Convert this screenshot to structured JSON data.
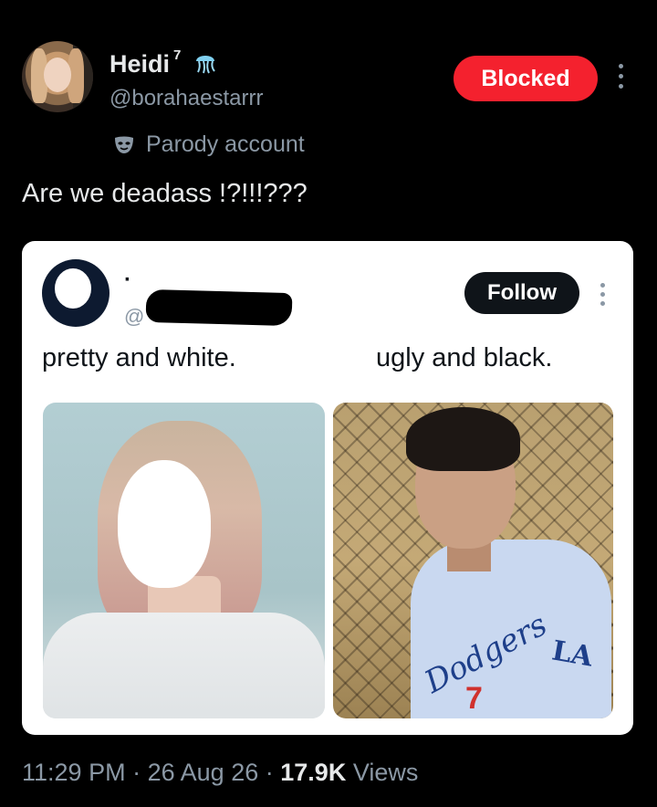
{
  "author": {
    "name": "Heidi",
    "name_superscript": "7",
    "handle": "@borahaestarrr",
    "badge_icon": "jellyfish-emoji",
    "label": "Parody account",
    "label_icon": "mask-icon"
  },
  "actions": {
    "blocked_label": "Blocked",
    "more_icon": "more-dots-icon"
  },
  "tweet": {
    "text": "Are we deadass !?!!!???"
  },
  "quoted": {
    "display_name": "·",
    "handle_prefix": "@",
    "follow_label": "Follow",
    "caption_left": "pretty and white.",
    "caption_right": "ugly and black.",
    "jersey_text": "Dodgers",
    "jersey_logo": "LA",
    "jersey_number": "7"
  },
  "meta": {
    "time": "11:29 PM",
    "separator": "·",
    "date": "26 Aug 26",
    "views_count": "17.9K",
    "views_label": "Views"
  },
  "colors": {
    "background": "#000000",
    "blocked_red": "#f4212e",
    "muted_text": "#8b98a5",
    "primary_text": "#e7e9ea"
  }
}
